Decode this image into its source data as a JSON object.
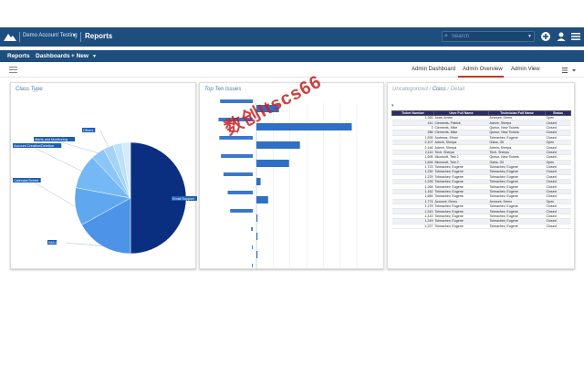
{
  "header": {
    "account": "Demo Account Testing",
    "page_title": "Reports",
    "search_placeholder": "Search"
  },
  "nav": {
    "items": [
      "Reports",
      "Dashboards",
      "+ New"
    ]
  },
  "tabs": {
    "items": [
      "Admin Dashboard",
      "Admin Overview",
      "Admin View"
    ],
    "active": "Admin Overview"
  },
  "panels": {
    "class_type": {
      "title": "Class Type"
    },
    "top_ten": {
      "title": "Top Ten Issues"
    },
    "detail": {
      "title_prefix": "Uncategorized /",
      "title_mid": " Class",
      "title_suffix": " / Detail"
    }
  },
  "watermark": "数创Itscs66",
  "chart_data": [
    {
      "type": "pie",
      "title": "Class Type",
      "slices": [
        {
          "label": "Email Support",
          "value": 50
        },
        {
          "label": "NULL",
          "value": 17
        },
        {
          "label": "Calendar/Sched",
          "value": 11
        },
        {
          "label": "Account Creation/Deletion",
          "value": 10
        },
        {
          "label": "Alerts and Monitoring",
          "value": 4
        },
        {
          "label": "Others",
          "value": 3
        },
        {
          "label": "",
          "value": 2.5
        },
        {
          "label": "",
          "value": 2.5
        }
      ],
      "colors": [
        "#0b2f80",
        "#4d93e8",
        "#5fa8f0",
        "#74b8f5",
        "#8cc6f7",
        "#a4d3f8",
        "#bcdffa",
        "#d3ebfc"
      ]
    },
    {
      "type": "bar",
      "title": "Top Ten Issues",
      "orientation": "horizontal",
      "series": [
        {
          "name": "",
          "values": [
            27,
            114,
            52,
            39,
            5,
            14,
            1,
            1,
            1,
            1
          ]
        },
        {
          "name": "",
          "values": [
            39,
            41,
            40,
            38,
            35,
            30,
            27,
            2,
            1,
            1
          ]
        }
      ],
      "xlim": [
        0,
        120
      ],
      "grid": true
    }
  ],
  "table": {
    "columns": [
      "Ticket Number",
      "User Full Name",
      "Technician Full Name",
      "Status"
    ],
    "rows": [
      [
        "1,265",
        "Acas, Amba",
        "Account, Demo",
        "Open"
      ],
      [
        "141",
        "Clements, Patrick",
        "Admin, Sherpa",
        "Closed"
      ],
      [
        "3",
        "Clements, Mike",
        "Queue, New Tickets",
        "Closed"
      ],
      [
        "286",
        "Clements, Mike",
        "Queue, New Tickets",
        "Closed"
      ],
      [
        "1,535",
        "Andrews, Ethan",
        "Tolmachev, Eugene",
        "Closed"
      ],
      [
        "2,107",
        "Admin, Sherpa",
        "Gaiss, Gil",
        "Open"
      ],
      [
        "2,146",
        "Admin, Sherpa",
        "Admin, Sherpa",
        "Closed"
      ],
      [
        "2,110",
        "Tech, Sherpa",
        "Tech, Sherpa",
        "Closed"
      ],
      [
        "1,695",
        "Microsoft, Test 2",
        "Queue, New Tickets",
        "Closed"
      ],
      [
        "1,694",
        "Microsoft, Test 2",
        "Gaiss, Gil",
        "Open"
      ],
      [
        "1,723",
        "Tolmachev, Eugene",
        "Tolmachev, Eugene",
        "Closed"
      ],
      [
        "1,230",
        "Tolmachev, Eugene",
        "Tolmachev, Eugene",
        "Closed"
      ],
      [
        "1,229",
        "Tolmachev, Eugene",
        "Tolmachev, Eugene",
        "Closed"
      ],
      [
        "1,226",
        "Tolmachev, Eugene",
        "Tolmachev, Eugene",
        "Closed"
      ],
      [
        "1,265",
        "Tolmachev, Eugene",
        "Tolmachev, Eugene",
        "Closed"
      ],
      [
        "1,162",
        "Tolmachev, Eugene",
        "Tolmachev, Eugene",
        "Closed"
      ],
      [
        "1,654",
        "Tolmachev, Eugene",
        "Tolmachev, Eugene",
        "Closed"
      ],
      [
        "1,774",
        "Account, Demo",
        "Account, Demo",
        "Open"
      ],
      [
        "1,278",
        "Tolmachev, Eugene",
        "Tolmachev, Eugene",
        "Closed"
      ],
      [
        "1,343",
        "Tolmachev, Eugene",
        "Tolmachev, Eugene",
        "Closed"
      ],
      [
        "1,415",
        "Tolmachev, Eugene",
        "Tolmachev, Eugene",
        "Closed"
      ],
      [
        "1,249",
        "Tolmachev, Eugene",
        "Tolmachev, Eugene",
        "Closed"
      ],
      [
        "1,227",
        "Tolmachev, Eugene",
        "Tolmachev, Eugene",
        "Closed"
      ]
    ]
  },
  "colors": {
    "header_bg": "#1e4e7e",
    "accent_red": "#c0392b",
    "bar_blue": "#2f6fc5",
    "table_header": "#2a2a6e"
  }
}
